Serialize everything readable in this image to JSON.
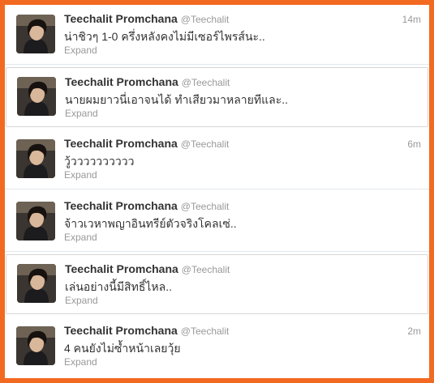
{
  "tweets": [
    {
      "name": "Teechalit Promchana",
      "handle": "@Teechalit",
      "time": "14m",
      "text": "น่าชิวๆ 1-0 ครึ่งหลังคงไม่มีเซอร์ไพรส์นะ..",
      "expand": "Expand"
    },
    {
      "name": "Teechalit Promchana",
      "handle": "@Teechalit",
      "time": "",
      "text": "นายผมยาวนี่เอาจนได้ ทำเสียวมาหลายทีและ..",
      "expand": "Expand"
    },
    {
      "name": "Teechalit Promchana",
      "handle": "@Teechalit",
      "time": "6m",
      "text": "วู้วววววววววว",
      "expand": "Expand"
    },
    {
      "name": "Teechalit Promchana",
      "handle": "@Teechalit",
      "time": "",
      "text": "จ้าวเวหาพญาอินทรีย์ตัวจริงโคลเซ่..",
      "expand": "Expand"
    },
    {
      "name": "Teechalit Promchana",
      "handle": "@Teechalit",
      "time": "",
      "text": "เล่นอย่างนี้มีสิทธิ์ไหล..",
      "expand": "Expand"
    },
    {
      "name": "Teechalit Promchana",
      "handle": "@Teechalit",
      "time": "2m",
      "text": "4 คนยังไม่ซ้ำหน้าเลยวุ้ย",
      "expand": "Expand"
    }
  ],
  "colors": {
    "frame_border": "#f26a21",
    "name": "#333333",
    "meta": "#999999"
  },
  "icons": {
    "avatar": "profile-photo"
  }
}
